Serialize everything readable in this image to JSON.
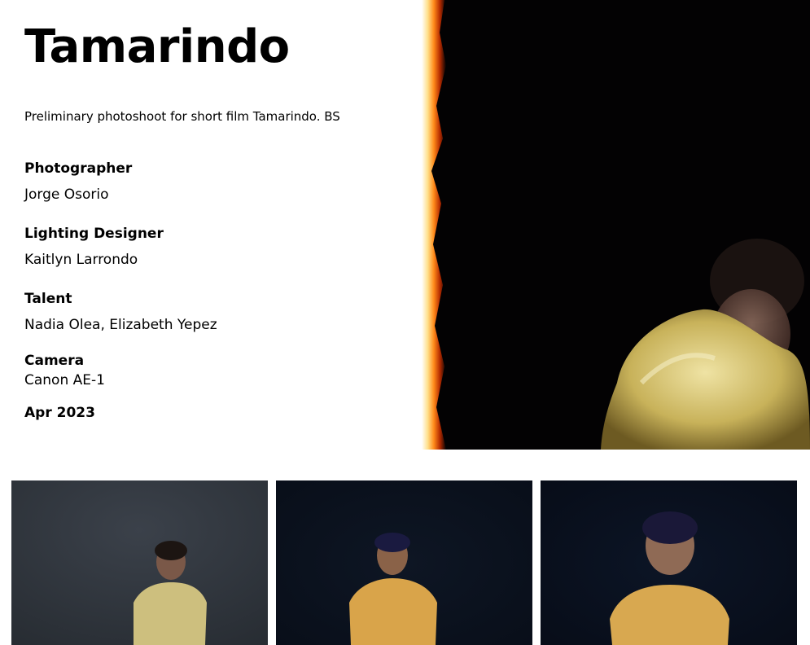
{
  "project": {
    "title": "Tamarindo",
    "description": "Preliminary photoshoot for short film Tamarindo. BS"
  },
  "credits": [
    {
      "label": "Photographer",
      "value": "Jorge Osorio"
    },
    {
      "label": "Lighting Designer",
      "value": "Kaitlyn Larrondo"
    },
    {
      "label": "Talent",
      "value": "Nadia Olea, Elizabeth Yepez"
    },
    {
      "label": "Camera",
      "value": "Canon AE-1"
    }
  ],
  "date": "Apr 2023",
  "gallery": {
    "hero_image": "woman-bent-over-film-burn-photo",
    "thumbnails": [
      "woman-seated-grey-backdrop-photo",
      "woman-seated-dark-backdrop-photo",
      "woman-closeup-dark-backdrop-photo"
    ]
  }
}
